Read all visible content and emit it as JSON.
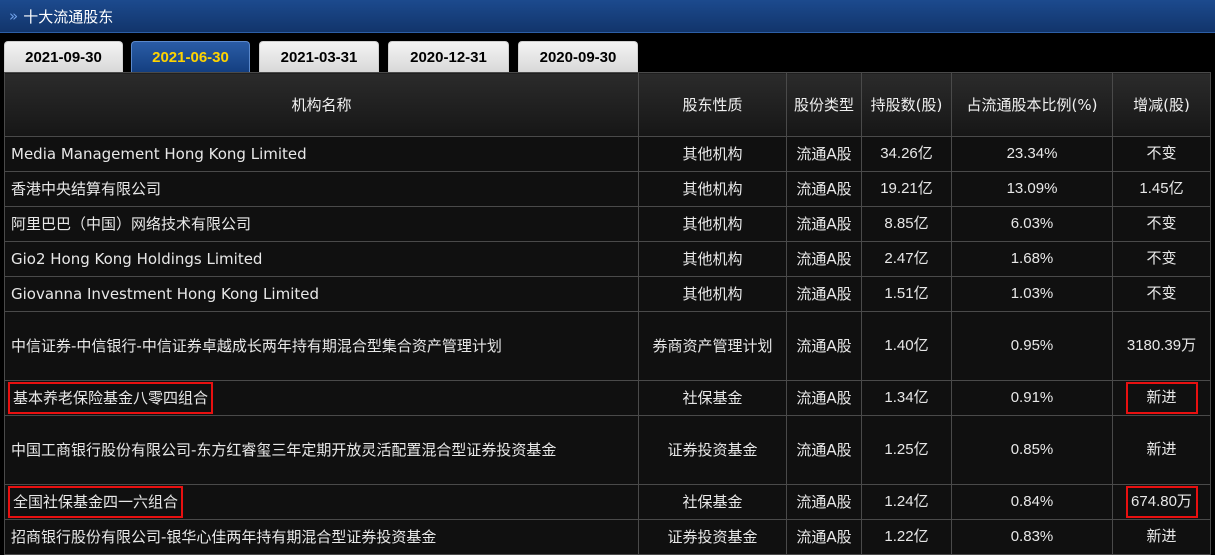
{
  "panel": {
    "title": "十大流通股东",
    "chevron": "»"
  },
  "tabs": [
    {
      "label": "2021-09-30",
      "active": false
    },
    {
      "label": "2021-06-30",
      "active": true
    },
    {
      "label": "2021-03-31",
      "active": false
    },
    {
      "label": "2020-12-31",
      "active": false
    },
    {
      "label": "2020-09-30",
      "active": false
    }
  ],
  "table": {
    "headers": [
      "机构名称",
      "股东性质",
      "股份类型",
      "持股数(股)",
      "占流通股本比例(%)",
      "增减(股)"
    ],
    "rows": [
      {
        "name": "Media Management Hong Kong Limited",
        "nature": "其他机构",
        "type": "流通A股",
        "shares": "34.26亿",
        "ratio": "23.34%",
        "change": "不变"
      },
      {
        "name": "香港中央结算有限公司",
        "nature": "其他机构",
        "type": "流通A股",
        "shares": "19.21亿",
        "ratio": "13.09%",
        "change": "1.45亿"
      },
      {
        "name": "阿里巴巴（中国）网络技术有限公司",
        "nature": "其他机构",
        "type": "流通A股",
        "shares": "8.85亿",
        "ratio": "6.03%",
        "change": "不变"
      },
      {
        "name": "Gio2 Hong Kong Holdings Limited",
        "nature": "其他机构",
        "type": "流通A股",
        "shares": "2.47亿",
        "ratio": "1.68%",
        "change": "不变"
      },
      {
        "name": "Giovanna Investment Hong Kong Limited",
        "nature": "其他机构",
        "type": "流通A股",
        "shares": "1.51亿",
        "ratio": "1.03%",
        "change": "不变"
      },
      {
        "name": "中信证券-中信银行-中信证券卓越成长两年持有期混合型集合资产管理计划",
        "nature": "券商资产管理计划",
        "type": "流通A股",
        "shares": "1.40亿",
        "ratio": "0.95%",
        "change": "3180.39万"
      },
      {
        "name": "基本养老保险基金八零四组合",
        "nature": "社保基金",
        "type": "流通A股",
        "shares": "1.34亿",
        "ratio": "0.91%",
        "change": "新进"
      },
      {
        "name": "中国工商银行股份有限公司-东方红睿玺三年定期开放灵活配置混合型证券投资基金",
        "nature": "证券投资基金",
        "type": "流通A股",
        "shares": "1.25亿",
        "ratio": "0.85%",
        "change": "新进"
      },
      {
        "name": "全国社保基金四一六组合",
        "nature": "社保基金",
        "type": "流通A股",
        "shares": "1.24亿",
        "ratio": "0.84%",
        "change": "674.80万"
      },
      {
        "name": "招商银行股份有限公司-银华心佳两年持有期混合型证券投资基金",
        "nature": "证券投资基金",
        "type": "流通A股",
        "shares": "1.22亿",
        "ratio": "0.83%",
        "change": "新进"
      }
    ]
  },
  "colors": {
    "highlight": "#e81010",
    "active_tab_text": "#ffd400",
    "title_bar": "#1c4a8e"
  }
}
